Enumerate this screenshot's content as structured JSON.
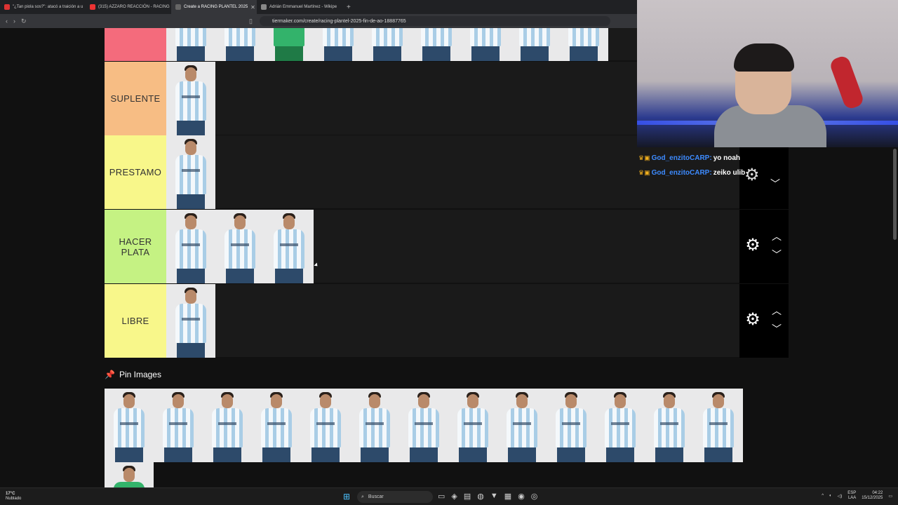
{
  "browser": {
    "tabs": [
      {
        "label": "\"¿Tan piola sos?\": atacó a traición a u",
        "color": "#d33"
      },
      {
        "label": "(315) AZZARO REACCIÓN - RACING",
        "color": "#e33"
      },
      {
        "label": "Create a RACING PLANTEL 2025",
        "color": "#555",
        "active": true
      },
      {
        "label": "Adrián Emmanuel Martínez - Wikipe",
        "color": "#777"
      }
    ],
    "url": "tiermaker.com/create/racing-plantel-2025-fin-de-ao-18887765"
  },
  "tiers": [
    {
      "label": "",
      "color": "#f46b7c",
      "players": 9
    },
    {
      "label": "SUPLENTE",
      "color": "#f7bd84",
      "players": 1
    },
    {
      "label": "PRESTAMO",
      "color": "#f8f78a",
      "players": 1
    },
    {
      "label": "HACER PLATA",
      "color": "#c5f283",
      "players": 3
    },
    {
      "label": "LIBRE",
      "color": "#f8f78a",
      "players": 1
    }
  ],
  "controls": {
    "gear_icon": "gear-icon",
    "up_icon": "chevron-up-icon",
    "down_icon": "chevron-down-icon"
  },
  "pin_section": {
    "title": "Pin Images",
    "count": 13
  },
  "chat": [
    {
      "user": "God_enzitoCARP:",
      "message": "yo noah"
    },
    {
      "user": "God_enzitoCARP:",
      "message": "zeiko ulib"
    }
  ],
  "taskbar": {
    "weather_temp": "17°C",
    "weather_desc": "Nublado",
    "search_placeholder": "Buscar",
    "lang_top": "ESP",
    "lang_bottom": "LAA",
    "time": "04:22",
    "date": "15/12/2025"
  }
}
